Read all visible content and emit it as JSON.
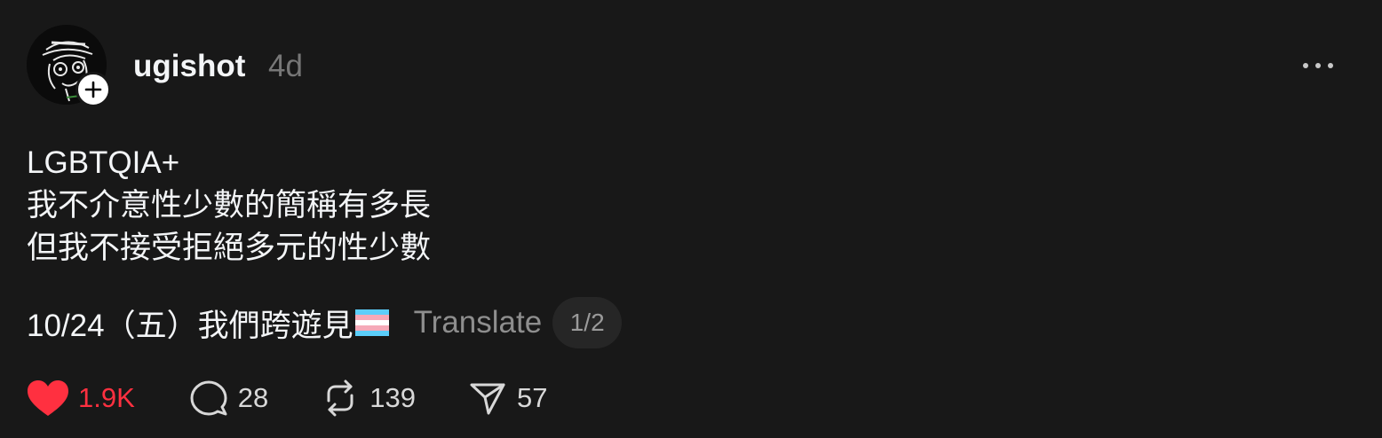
{
  "post": {
    "username": "ugishot",
    "timestamp": "4d",
    "text_lines": [
      "LGBTQIA+",
      "我不介意性少數的簡稱有多長",
      "但我不接受拒絕多元的性少數"
    ],
    "footer_text": "10/24（五）我們跨遊見",
    "flag_emoji": "transgender-flag",
    "translate_label": "Translate",
    "page_indicator": "1/2"
  },
  "actions": {
    "likes": "1.9K",
    "comments": "28",
    "reposts": "139",
    "shares": "57"
  },
  "icons": {
    "avatar": "avatar",
    "follow": "plus-icon",
    "more": "more-horizontal-icon",
    "like": "heart-icon",
    "comment": "comment-icon",
    "repost": "repost-icon",
    "share": "send-icon"
  },
  "colors": {
    "background": "#181818",
    "text": "#f3f5f7",
    "muted": "#777777",
    "like_red": "#ff3040",
    "flag_blue": "#5bcefa",
    "flag_pink": "#f5a9b8",
    "flag_white": "#ffffff"
  }
}
